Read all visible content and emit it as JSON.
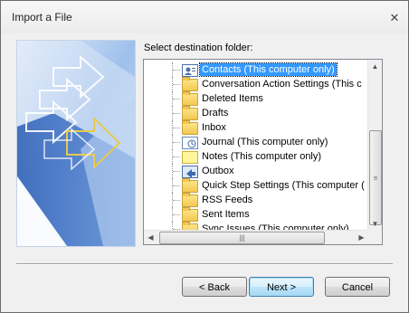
{
  "window": {
    "title": "Import a File"
  },
  "label": "Select destination folder:",
  "folders": [
    {
      "name": "Contacts (This computer only)",
      "icon": "contacts-icon",
      "selected": true
    },
    {
      "name": "Conversation Action Settings (This c",
      "icon": "folder-icon",
      "selected": false
    },
    {
      "name": "Deleted Items",
      "icon": "folder-icon",
      "selected": false
    },
    {
      "name": "Drafts",
      "icon": "folder-icon",
      "selected": false
    },
    {
      "name": "Inbox",
      "icon": "inbox-icon",
      "selected": false
    },
    {
      "name": "Journal (This computer only)",
      "icon": "journal-icon",
      "selected": false
    },
    {
      "name": "Notes (This computer only)",
      "icon": "notes-icon",
      "selected": false
    },
    {
      "name": "Outbox",
      "icon": "outbox-icon",
      "selected": false
    },
    {
      "name": "Quick Step Settings (This computer (",
      "icon": "folder-icon",
      "selected": false
    },
    {
      "name": "RSS Feeds",
      "icon": "folder-icon",
      "selected": false
    },
    {
      "name": "Sent Items",
      "icon": "folder-icon",
      "selected": false
    },
    {
      "name": "Sync Issues (This computer only)",
      "icon": "folder-icon",
      "selected": false
    }
  ],
  "buttons": {
    "back": "< Back",
    "next": "Next >",
    "cancel": "Cancel"
  },
  "colors": {
    "selection": "#3399ff",
    "dialog_bg": "#f0f0f0"
  }
}
